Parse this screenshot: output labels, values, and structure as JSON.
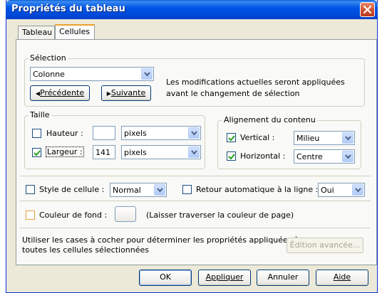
{
  "window": {
    "title": "Propriétés du tableau"
  },
  "tabs": [
    {
      "label": "Tableau"
    },
    {
      "label": "Cellules"
    }
  ],
  "selection": {
    "legend": "Sélection",
    "combo_value": "Colonne",
    "info_line1": "Les modifications actuelles seront appliquées",
    "info_line2": "avant le changement de sélection",
    "prev_label": "Précédente",
    "next_label": "Suivante"
  },
  "size": {
    "legend": "Taille",
    "height_label": "Hauteur :",
    "height_value": "",
    "height_unit": "pixels",
    "height_checked": false,
    "width_label": "Largeur :",
    "width_value": "141",
    "width_unit": "pixels",
    "width_checked": true
  },
  "alignment": {
    "legend": "Alignement du contenu",
    "vertical_label": "Vertical :",
    "vertical_value": "Milieu",
    "vertical_checked": true,
    "horizontal_label": "Horizontal :",
    "horizontal_value": "Centre",
    "horizontal_checked": true
  },
  "style": {
    "style_label": "Style de cellule :",
    "style_value": "Normal",
    "wrap_label": "Retour automatique à la ligne :",
    "wrap_value": "Oui"
  },
  "background": {
    "label": "Couleur de fond :",
    "hint": "(Laisser traverser la couleur de page)"
  },
  "advanced": {
    "text_line1": "Utiliser les cases à cocher pour déterminer les propriétés appliquées à",
    "text_line2": "toutes les cellules sélectionnées",
    "button_label": "Édition avancée..."
  },
  "footer": {
    "ok_label": "OK",
    "apply_label": "Appliquer",
    "cancel_label": "Annuler",
    "help_label": "Aide"
  },
  "colors": {
    "titlebar": "#0055e5",
    "window_bg": "#ece9d8",
    "active_tab_accent": "#f0a02b",
    "checkbox_tick": "#21a121"
  }
}
